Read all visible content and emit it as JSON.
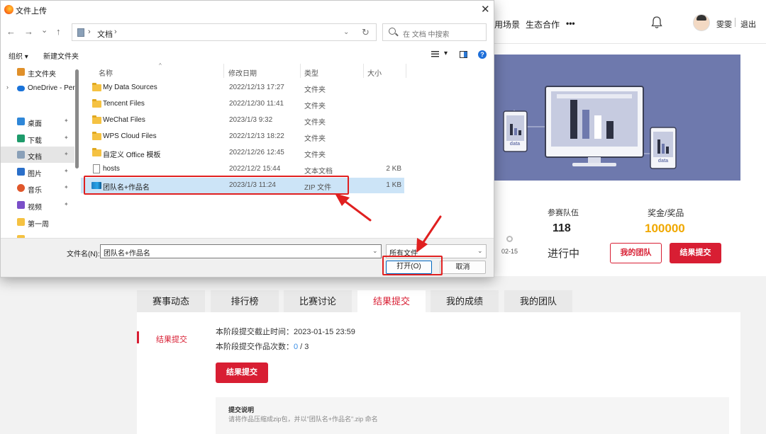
{
  "page": {
    "nav": [
      "用场景",
      "生态合作",
      "•••"
    ],
    "user_name": "雯雯",
    "logout": "退出",
    "stats": {
      "teams_label": "参赛队伍",
      "teams_value": "118",
      "prize_label": "奖金/奖品",
      "prize_value": "100000",
      "status": "进行中",
      "date": "02-15"
    },
    "my_team_button": "我的团队",
    "submit_button": "结果提交",
    "hero_screen_caption": "data",
    "tabs": [
      "赛事动态",
      "排行榜",
      "比赛讨论",
      "结果提交",
      "我的成绩",
      "我的团队"
    ],
    "active_tab": "结果提交",
    "panel": {
      "side_label": "结果提交",
      "deadline_label": "本阶段提交截止时间：",
      "deadline_value": "2023-01-15 23:59",
      "count_label": "本阶段提交作品次数：",
      "count_used": "0",
      "count_sep": " / ",
      "count_total": "3",
      "submit_button": "结果提交",
      "note_title": "提交说明",
      "note_text": "请将作品压缩成zip包，并以\"团队名+作品名\".zip 命名"
    },
    "colors": {
      "brand_red": "#d81e33",
      "hero_bg": "#6e79ad",
      "annotation_red": "#e02020"
    }
  },
  "dialog": {
    "title": "文件上传",
    "close": "✕",
    "back": "←",
    "forward": "→",
    "recent": "⌄",
    "up": "↑",
    "path_sep": "›",
    "path": "文档",
    "path_trail": "›",
    "addr_dropdown": "⌄",
    "refresh": "↻",
    "search_placeholder": "在 文档 中搜索",
    "organize": "组织 ▾",
    "new_folder": "新建文件夹",
    "view_dropdown": "▾",
    "help": "?",
    "nav": [
      {
        "label": "主文件夹",
        "icon": "home-icon",
        "pinned": false
      },
      {
        "label": "OneDrive - Per",
        "icon": "cloud-icon",
        "pinned": false
      },
      {
        "label": "桌面",
        "icon": "desktop-icon",
        "pinned": true
      },
      {
        "label": "下载",
        "icon": "download-icon",
        "pinned": true
      },
      {
        "label": "文档",
        "icon": "documents-icon",
        "pinned": true
      },
      {
        "label": "图片",
        "icon": "pictures-icon",
        "pinned": true
      },
      {
        "label": "音乐",
        "icon": "music-icon",
        "pinned": true
      },
      {
        "label": "视频",
        "icon": "videos-icon",
        "pinned": true
      },
      {
        "label": "第一周",
        "icon": "folder-icon",
        "pinned": false
      },
      {
        "label": "",
        "icon": "folder-icon",
        "pinned": false
      }
    ],
    "pin_glyph": "✦",
    "chevron": "›",
    "columns": {
      "name": "名称",
      "date": "修改日期",
      "type": "类型",
      "size": "大小"
    },
    "sort_glyph": "^",
    "files": [
      {
        "name": "My Data Sources",
        "date": "2022/12/13 17:27",
        "type": "文件夹",
        "size": "",
        "kind": "folder"
      },
      {
        "name": "Tencent Files",
        "date": "2022/12/30 11:41",
        "type": "文件夹",
        "size": "",
        "kind": "folder"
      },
      {
        "name": "WeChat Files",
        "date": "2023/1/3 9:32",
        "type": "文件夹",
        "size": "",
        "kind": "folder"
      },
      {
        "name": "WPS Cloud Files",
        "date": "2022/12/13 18:22",
        "type": "文件夹",
        "size": "",
        "kind": "folder"
      },
      {
        "name": "自定义 Office 模板",
        "date": "2022/12/26 12:45",
        "type": "文件夹",
        "size": "",
        "kind": "folder"
      },
      {
        "name": "hosts",
        "date": "2022/12/2 15:44",
        "type": "文本文档",
        "size": "2 KB",
        "kind": "doc"
      },
      {
        "name": "团队名+作品名",
        "date": "2023/1/3 11:24",
        "type": "ZIP 文件",
        "size": "1 KB",
        "kind": "zip"
      }
    ],
    "filename_label": "文件名(N):",
    "filename_value": "团队名+作品名",
    "dropdown_glyph": "⌄",
    "filetype": "所有文件",
    "open_button": "打开(O)",
    "cancel_button": "取消"
  }
}
